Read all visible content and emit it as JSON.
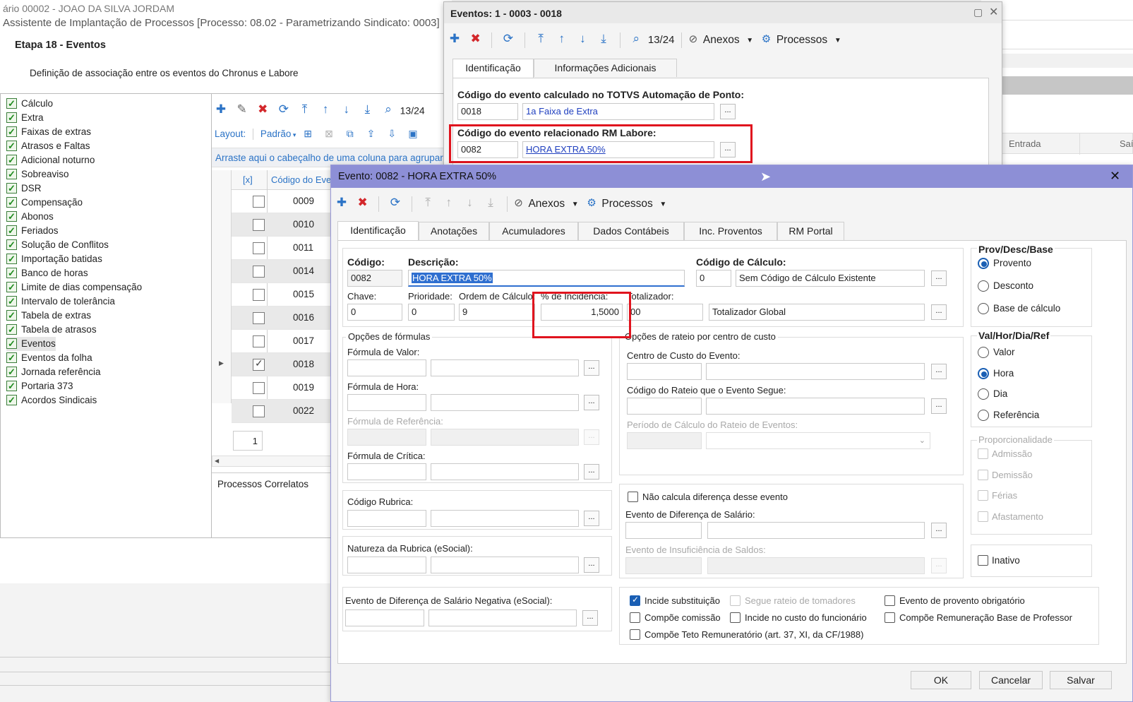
{
  "bg_window": {
    "top_title": "ário 00002 - JOAO DA SILVA JORDAM",
    "title": "Assistente de Implantação de Processos [Processo: 08.02 - Parametrizando Sindicato: 0003]",
    "step": "Etapa 18 - Eventos",
    "description": "Definição de associação entre os eventos do Chronus e Labore",
    "tree": [
      "Cálculo",
      "Extra",
      "Faixas de extras",
      "Atrasos e Faltas",
      "Adicional noturno",
      "Sobreaviso",
      "DSR",
      "Compensação",
      "Abonos",
      "Feriados",
      "Solução de Conflitos",
      "Importação batidas",
      "Banco de horas",
      "Limite de dias compensação",
      "Intervalo de tolerância",
      "Tabela de extras",
      "Tabela de atrasos",
      "Eventos",
      "Eventos da folha",
      "Jornada referência",
      "Portaria 373",
      "Acordos Sindicais"
    ],
    "grid_counter": "13/24",
    "layout_label": "Layout:",
    "layout_value": "Padrão",
    "group_hint": "Arraste aqui o cabeçalho de uma coluna para agrupar",
    "grid_col_x": "[x]",
    "grid_col_code": "Código do Eve",
    "grid_rows": [
      {
        "code": "0009",
        "checked": false
      },
      {
        "code": "0010",
        "checked": false
      },
      {
        "code": "0011",
        "checked": false
      },
      {
        "code": "0014",
        "checked": false
      },
      {
        "code": "0015",
        "checked": false
      },
      {
        "code": "0016",
        "checked": false
      },
      {
        "code": "0017",
        "checked": false
      },
      {
        "code": "0018",
        "checked": true
      },
      {
        "code": "0019",
        "checked": false
      },
      {
        "code": "0022",
        "checked": false
      }
    ],
    "page_number": "1",
    "related_processes": "Processos Correlatos",
    "right_col_entrada": "Entrada",
    "right_col_sai": "Saí"
  },
  "eventos_window": {
    "title": "Eventos: 1 - 0003 - 0018",
    "counter": "13/24",
    "anexos": "Anexos",
    "processos": "Processos",
    "tabs": [
      "Identificação",
      "Informações Adicionais"
    ],
    "calc_label": "Código do evento calculado no TOTVS Automação de Ponto:",
    "calc_code": "0018",
    "calc_desc": "1a Faixa de Extra",
    "rel_label": "Código do evento relacionado RM Labore:",
    "rel_code": "0082",
    "rel_desc": "HORA EXTRA 50%",
    "ellipsis": "..."
  },
  "evento_dialog": {
    "title": "Evento: 0082 - HORA EXTRA 50%",
    "anexos": "Anexos",
    "processos": "Processos",
    "tabs": [
      "Identificação",
      "Anotações",
      "Acumuladores",
      "Dados Contábeis",
      "Inc. Proventos",
      "RM Portal"
    ],
    "codigo_label": "Código:",
    "codigo": "0082",
    "descricao_label": "Descrição:",
    "descricao": "HORA EXTRA 50%",
    "codcalc_label": "Código de Cálculo:",
    "codcalc": "0",
    "codcalc_desc": "Sem Código de Cálculo Existente",
    "chave_label": "Chave:",
    "chave": "0",
    "prioridade_label": "Prioridade:",
    "prioridade": "0",
    "ordem_label": "Ordem de Cálculo:",
    "ordem": "9",
    "incidencia_label": "% de Incidência:",
    "incidencia": "1,5000",
    "totalizador_label": "Totalizador:",
    "totalizador": "00",
    "totalizador_desc": "Totalizador Global",
    "formulas_title": "Opções de fórmulas",
    "formula_valor": "Fórmula de Valor:",
    "formula_hora": "Fórmula de Hora:",
    "formula_ref": "Fórmula de Referência:",
    "formula_critica": "Fórmula de Crítica:",
    "rateio_title": "Opções de rateio por centro de custo",
    "centro_custo": "Centro de Custo do Evento:",
    "cod_rateio": "Código do Rateio que o Evento Segue:",
    "periodo_rateio": "Período de Cálculo do Rateio de Eventos:",
    "codigo_rubrica": "Código Rubrica:",
    "natureza_rubrica": "Natureza da Rubrica (eSocial):",
    "nao_calcula": "Não calcula diferença desse evento",
    "evento_dif_salario": "Evento de Diferença de Salário:",
    "evento_insuficiencia": "Evento de Insuficiência de Saldos:",
    "evento_dif_neg": "Evento de Diferença de Salário Negativa (eSocial):",
    "flags": [
      {
        "label": "Incide substituição",
        "checked": true,
        "disabled": false
      },
      {
        "label": "Segue rateio de tomadores",
        "checked": false,
        "disabled": true
      },
      {
        "label": "Evento de provento obrigatório",
        "checked": false,
        "disabled": false
      },
      {
        "label": "Compõe comissão",
        "checked": false,
        "disabled": false
      },
      {
        "label": "Incide no custo do funcionário",
        "checked": false,
        "disabled": false
      },
      {
        "label": "Compõe Remuneração Base de Professor",
        "checked": false,
        "disabled": false
      },
      {
        "label": "Compõe Teto Remuneratório (art. 37, XI, da CF/1988)",
        "checked": false,
        "disabled": false
      }
    ],
    "prov_title": "Prov/Desc/Base",
    "prov_options": [
      {
        "label": "Provento",
        "selected": true
      },
      {
        "label": "Desconto",
        "selected": false
      },
      {
        "label": "Base de cálculo",
        "selected": false
      }
    ],
    "val_title": "Val/Hor/Dia/Ref",
    "val_options": [
      {
        "label": "Valor",
        "selected": false
      },
      {
        "label": "Hora",
        "selected": true
      },
      {
        "label": "Dia",
        "selected": false
      },
      {
        "label": "Referência",
        "selected": false
      }
    ],
    "prop_title": "Proporcionalidade",
    "prop_options": [
      "Admissão",
      "Demissão",
      "Férias",
      "Afastamento"
    ],
    "inativo": "Inativo",
    "ok": "OK",
    "cancelar": "Cancelar",
    "salvar": "Salvar",
    "ellipsis": "..."
  },
  "colors": {
    "dialog_title_bar": "#8d8fd6",
    "highlight": "#e0141e",
    "selection": "#2f6fd0",
    "link": "#1f3fbf"
  }
}
